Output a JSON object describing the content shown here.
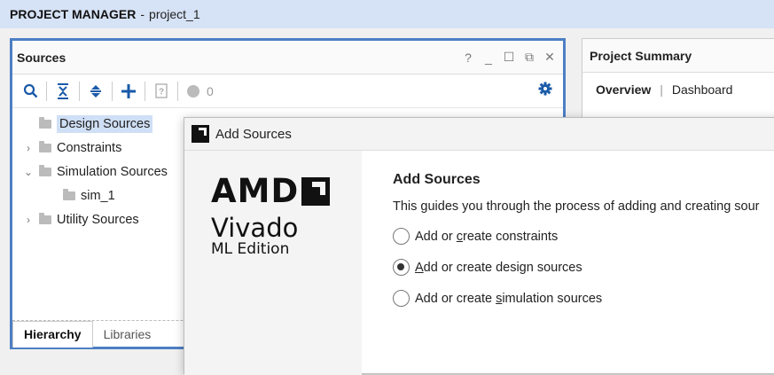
{
  "header": {
    "title": "PROJECT MANAGER",
    "separator": "-",
    "project": "project_1"
  },
  "sources_panel": {
    "title": "Sources",
    "window_buttons": [
      "?",
      "_",
      "☐",
      "⧉",
      "✕"
    ],
    "toolbar": {
      "status_count": "0"
    },
    "tree": [
      {
        "label": "Design Sources",
        "caret": "",
        "selected": true
      },
      {
        "label": "Constraints",
        "caret": "›"
      },
      {
        "label": "Simulation Sources",
        "caret": "⌄"
      },
      {
        "label": "sim_1",
        "caret": ""
      },
      {
        "label": "Utility Sources",
        "caret": "›"
      }
    ],
    "bottom_tabs": {
      "hierarchy": "Hierarchy",
      "libraries": "Libraries"
    }
  },
  "summary_panel": {
    "title": "Project Summary",
    "tab_overview": "Overview",
    "tab_dashboard": "Dashboard"
  },
  "dialog": {
    "title": "Add Sources",
    "brand": {
      "logo": "AMD",
      "product": "Vivado",
      "edition": "ML Edition"
    },
    "heading": "Add Sources",
    "description": "This guides you through the process of adding and creating sour",
    "options": [
      {
        "pre": "Add or ",
        "key": "c",
        "post": "reate constraints",
        "selected": false
      },
      {
        "pre": "",
        "key": "A",
        "post": "dd or create design sources",
        "selected": true
      },
      {
        "pre": "Add or create ",
        "key": "s",
        "post": "imulation sources",
        "selected": false
      }
    ]
  }
}
